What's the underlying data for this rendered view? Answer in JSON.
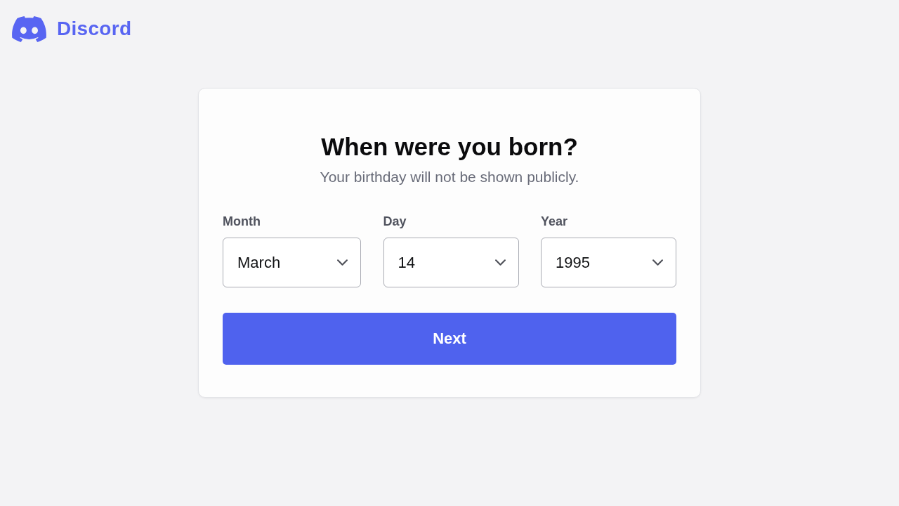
{
  "logo": {
    "wordmark": "Discord"
  },
  "card": {
    "title": "When were you born?",
    "subtitle": "Your birthday will not be shown publicly.",
    "fields": [
      {
        "label": "Month",
        "value": "March"
      },
      {
        "label": "Day",
        "value": "14"
      },
      {
        "label": "Year",
        "value": "1995"
      }
    ],
    "button": {
      "label": "Next"
    }
  }
}
